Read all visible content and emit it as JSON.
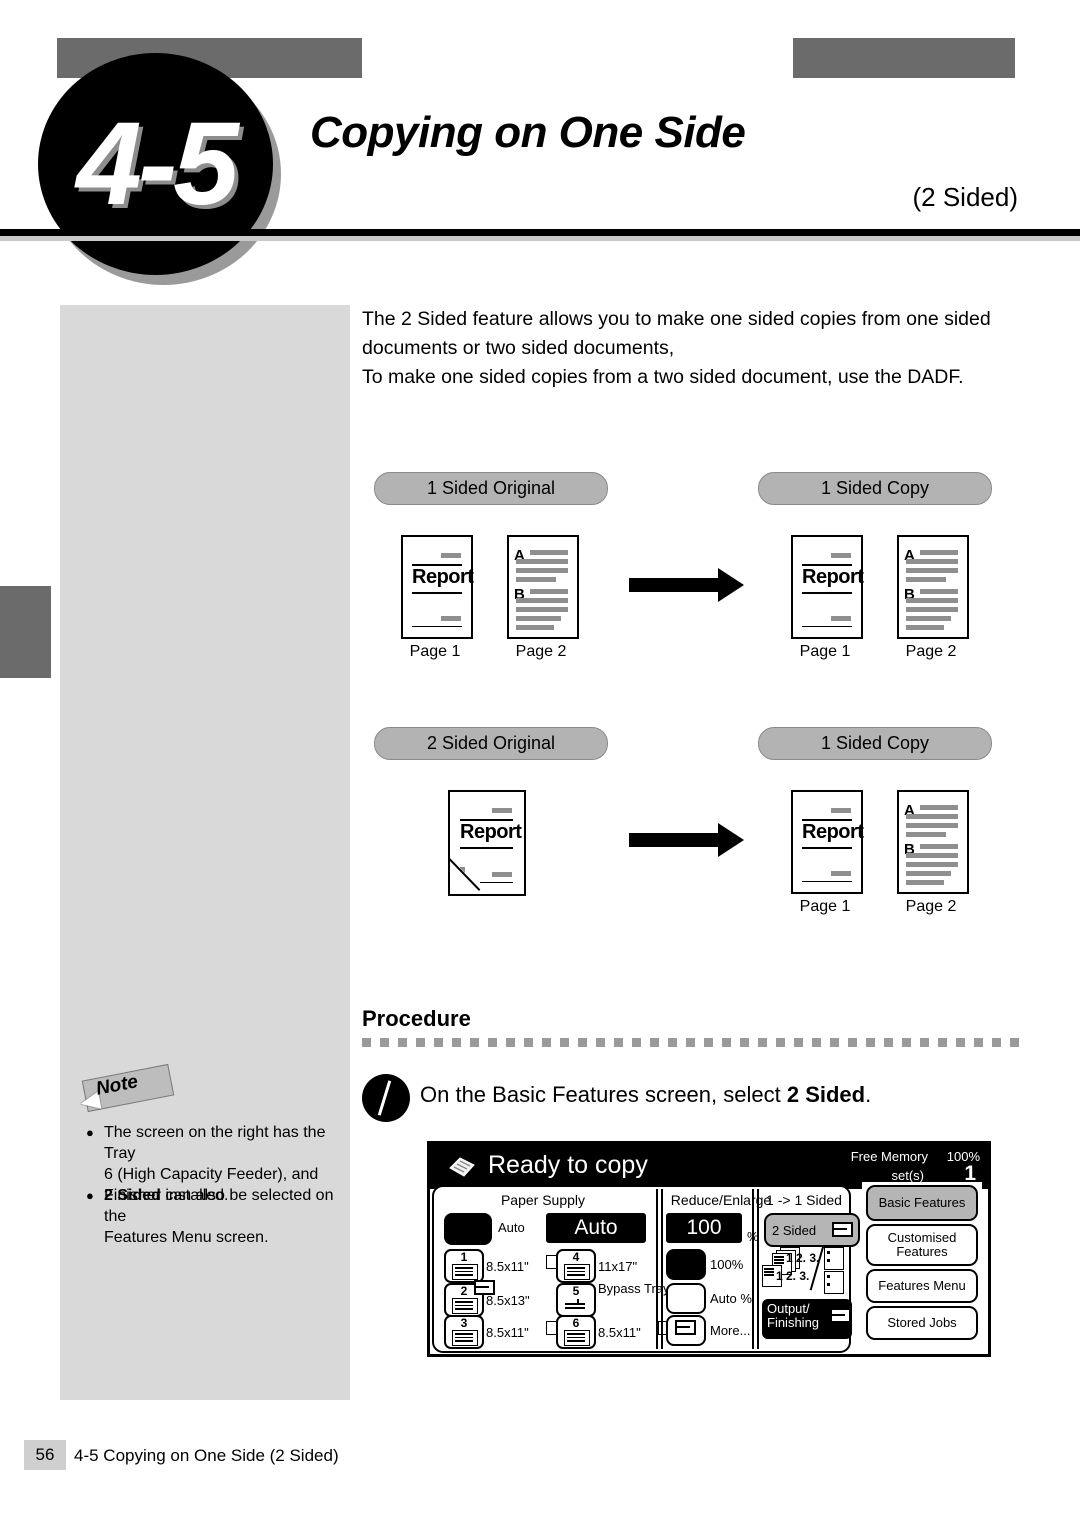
{
  "header": {
    "chapter_number": "4-5",
    "title": "Copying on One Side",
    "subtitle": "(2 Sided)"
  },
  "intro": {
    "line1": "The 2 Sided feature allows you to make one sided copies from one sided",
    "line2": "documents or two sided documents,",
    "line3": "To make one sided copies from a two sided document, use the DADF."
  },
  "diagrams": [
    {
      "source_label": "1 Sided Original",
      "target_label": "1 Sided Copy",
      "source_pages": [
        {
          "type": "report",
          "caption": "Page 1",
          "title": "Report"
        },
        {
          "type": "text",
          "caption": "Page 2",
          "marks": [
            "A",
            "B"
          ]
        }
      ],
      "target_pages": [
        {
          "type": "report",
          "caption": "Page 1",
          "title": "Report"
        },
        {
          "type": "text",
          "caption": "Page 2",
          "marks": [
            "A",
            "B"
          ]
        }
      ]
    },
    {
      "source_label": "2 Sided Original",
      "target_label": "1 Sided Copy",
      "source_pages": [
        {
          "type": "report-folded",
          "caption": "",
          "title": "Report"
        }
      ],
      "target_pages": [
        {
          "type": "report",
          "caption": "Page 1",
          "title": "Report"
        },
        {
          "type": "text",
          "caption": "Page 2",
          "marks": [
            "A",
            "B"
          ]
        }
      ]
    }
  ],
  "procedure": {
    "heading": "Procedure",
    "step_number": "1",
    "step_text_before": "On the Basic Features screen, select ",
    "step_text_bold": "2 Sided",
    "step_text_after": "."
  },
  "note": {
    "label": "Note",
    "items": [
      {
        "lines": [
          "The screen on the right has the Tray",
          "6 (High Capacity Feeder), and",
          "Finisher installed."
        ],
        "bold_prefix": ""
      },
      {
        "lines": [
          " can also be selected on the",
          "Features Menu screen."
        ],
        "bold_prefix": "2 Sided"
      }
    ]
  },
  "copier_screen": {
    "status": "Ready to copy",
    "free_memory_label": "Free Memory",
    "free_memory_value": "100%",
    "sets_label": "set(s)",
    "sets_value": "1",
    "paper_supply": {
      "title": "Paper Supply",
      "auto_label": "Auto",
      "auto_display": "Auto",
      "trays": [
        {
          "number": "1",
          "size": "8.5x11\"",
          "has_mark": true
        },
        {
          "number": "2",
          "size": "8.5x13\"",
          "has_mark": false
        },
        {
          "number": "3",
          "size": "8.5x11\"",
          "has_mark": true
        },
        {
          "number": "4",
          "size": "11x17\"",
          "has_mark": false
        },
        {
          "number": "5",
          "size": "Bypass Tray",
          "has_mark": false
        },
        {
          "number": "6",
          "size": "8.5x11\"",
          "has_mark": true
        }
      ]
    },
    "reduce_enlarge": {
      "title": "Reduce/Enlarge",
      "display_value": "100",
      "display_unit": "%",
      "options": [
        {
          "label": "100%",
          "selected": true
        },
        {
          "label": "Auto %",
          "selected": false
        },
        {
          "label": "More...",
          "selected": false
        }
      ]
    },
    "two_sided": {
      "title": "1 -> 1 Sided",
      "button_label": "2 Sided",
      "output_button_line1": "Output/",
      "output_button_line2": "Finishing",
      "icon_text_top": "1 2. 3.",
      "icon_text_bottom": "1 2. 3."
    },
    "tabs": [
      {
        "label": "Basic Features",
        "active": true
      },
      {
        "label": "Customised Features",
        "active": false
      },
      {
        "label": "Features Menu",
        "active": false
      },
      {
        "label": "Stored Jobs",
        "active": false
      }
    ]
  },
  "footer": {
    "page_number": "56",
    "text": "4-5  Copying on One Side (2 Sided)"
  },
  "colors": {
    "gray_bar": "#6b6b6b",
    "panel_gray": "#d9d9d9",
    "pill_gray": "#b3b3b3",
    "button_gray": "#b5b5b5"
  }
}
